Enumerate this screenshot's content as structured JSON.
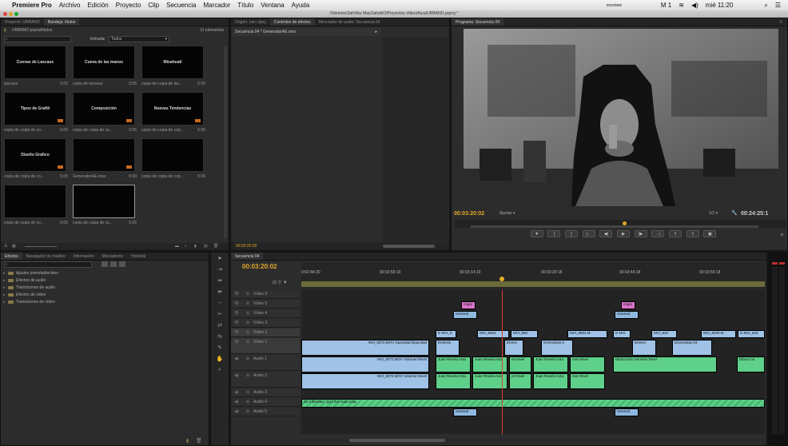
{
  "menubar": {
    "apple": "",
    "app": "Premiere Pro",
    "items": [
      "Archivo",
      "Edición",
      "Proyecto",
      "Clip",
      "Secuencia",
      "Marcador",
      "Título",
      "Ventana",
      "Ayuda"
    ],
    "status_user": "vxcxnew",
    "status_misc": "M 1",
    "clock": "mié 11:20"
  },
  "window": {
    "title": "/Volumes/JahVibs Mac/JahvibO/Proyectos Video/Aura/URBANO.prproj *"
  },
  "project": {
    "tabs": [
      "Proyecto: URBANO",
      "Bandeja: títulos"
    ],
    "path": "URBANO.prproj\\títulos",
    "count": "11 elementos",
    "search_placeholder": "",
    "entrada_label": "Entrada:",
    "entrada_value": "Todos",
    "items": [
      {
        "thumb": "Cuevas de Lascaux",
        "name": "lascaux",
        "dur": "5:05",
        "badge": false
      },
      {
        "thumb": "Cueva de las manos",
        "name": "copia de lascaux",
        "dur": "5:05",
        "badge": false
      },
      {
        "thumb": "Mixahuatl",
        "name": "copia de copia de las...",
        "dur": "5:05",
        "badge": false
      },
      {
        "thumb": "Tipos de Grafiti",
        "name": "copia de copia de co...",
        "dur": "5:05",
        "badge": true
      },
      {
        "thumb": "Composición",
        "name": "copia de copia de co...",
        "dur": "5:05",
        "badge": true
      },
      {
        "thumb": "Nuevas Tendencias",
        "name": "copia de copia de cop...",
        "dur": "5:05",
        "badge": true
      },
      {
        "thumb": "Diseño Gráfico",
        "name": "copia de copia de co...",
        "dur": "5:05",
        "badge": true
      },
      {
        "thumb": "",
        "name": "GeneradorAE.mov",
        "dur": "5:00",
        "badge": true
      },
      {
        "thumb": "",
        "name": "copia de copia de cop...",
        "dur": "5:05",
        "badge": false
      },
      {
        "thumb": "",
        "name": "copia de copia de co...",
        "dur": "5:05",
        "badge": false
      },
      {
        "thumb": "",
        "name": "copia de copia de co...",
        "dur": "5:05",
        "badge": false
      }
    ]
  },
  "effects_panel": {
    "tabs": [
      "Efectos",
      "Navegador de medios",
      "Información",
      "Marcadores",
      "Historial"
    ],
    "items": [
      "Ajustes preestablecidos",
      "Efectos de audio",
      "Transiciones de audio",
      "Efectos de vídeo",
      "Transiciones de vídeo"
    ]
  },
  "effect_controls": {
    "tabs": [
      "Origen: (sin clips)",
      "Controles de efectos",
      "Mezclador de audio: Secuencia 04"
    ],
    "clip": "Secuencia 04 * GeneradorAE.mov",
    "timecode": "00:03:20:02"
  },
  "program": {
    "tab": "Programa: Secuencia 04",
    "timecode": "00:03:20:02",
    "fit": "Ajustar",
    "resolution": "1/2",
    "duration": "00:24:25:1"
  },
  "timeline": {
    "tab": "Secuencia 04",
    "timecode": "00:03:20:02",
    "ruler": [
      "0:02:44:20",
      "00:02:59:19",
      "00:03:14:19",
      "00:03:29:18",
      "00:03:44:18",
      "00:03:59:18"
    ],
    "tracks": [
      "Vídeo 6",
      "Vídeo 5",
      "Vídeo 4",
      "Vídeo 3",
      "Vídeo 2",
      "Vídeo 1",
      "Audio 1",
      "Audio 2",
      "Audio 3",
      "Audio 4",
      "Audio 5"
    ],
    "clips": {
      "copia1": "copia",
      "copia2": "copia",
      "gen1": "General",
      "gen2": "General",
      "gen3": "General",
      "gen4": "General",
      "v2a": "D MVI_8",
      "v2b": "MVI_8663",
      "v2c": "MVI_866",
      "v2d": "MVI_8664.M",
      "v2e": "D MVI",
      "v2f": "MVI_833",
      "v2g": "MVI_8330.M",
      "v2h": "D MVI_833",
      "v1a": "MVI_6072.MOV Opacidad:Opacidad",
      "v1b": "Entrevis",
      "v1c": "Entrev",
      "v1d": "Entrevistas.0",
      "v1e": "Entrevi",
      "v1f": "Entrevistas.03",
      "a1a": "MVI_6072.MOV Volumen:Nivel",
      "a1b": "Juan Revelo.m4a",
      "a1c": "Juan Revelo.m4a",
      "a1d": "en:Nivel",
      "a1e": "Juan Revelo.m4a",
      "a1f": "men:Nivel",
      "a1g": "Dibu3.m4a Volumen:Nivel",
      "a1h": "Dibu4.m4",
      "a2a": "MVI_6072.MOV Volumen:Nivel",
      "a2b": "Juan Revelo.m4a",
      "a2c": "Juan Revelo.m4a",
      "a2d": "en:Nivel",
      "a2e": "Juan Revelo.m4a",
      "a2f": "men:Nivel",
      "a4": "03 3 libertad - jazz the roots.m4a"
    }
  }
}
